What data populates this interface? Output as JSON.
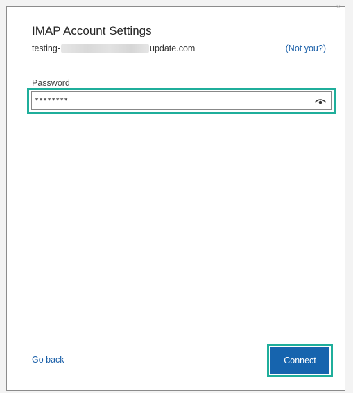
{
  "dialog": {
    "title": "IMAP Account Settings",
    "account": {
      "prefix": "testing-",
      "suffix": "update.com"
    },
    "not_you_link": "(Not you?)",
    "password": {
      "label": "Password",
      "value": "********"
    },
    "footer": {
      "go_back_link": "Go back",
      "connect_label": "Connect"
    }
  },
  "colors": {
    "accent": "#1664ae",
    "link": "#1a5fa8",
    "highlight": "#1fae9b"
  },
  "icons": {
    "reveal_password": "eye-icon",
    "account_redaction": "blurred-text"
  }
}
